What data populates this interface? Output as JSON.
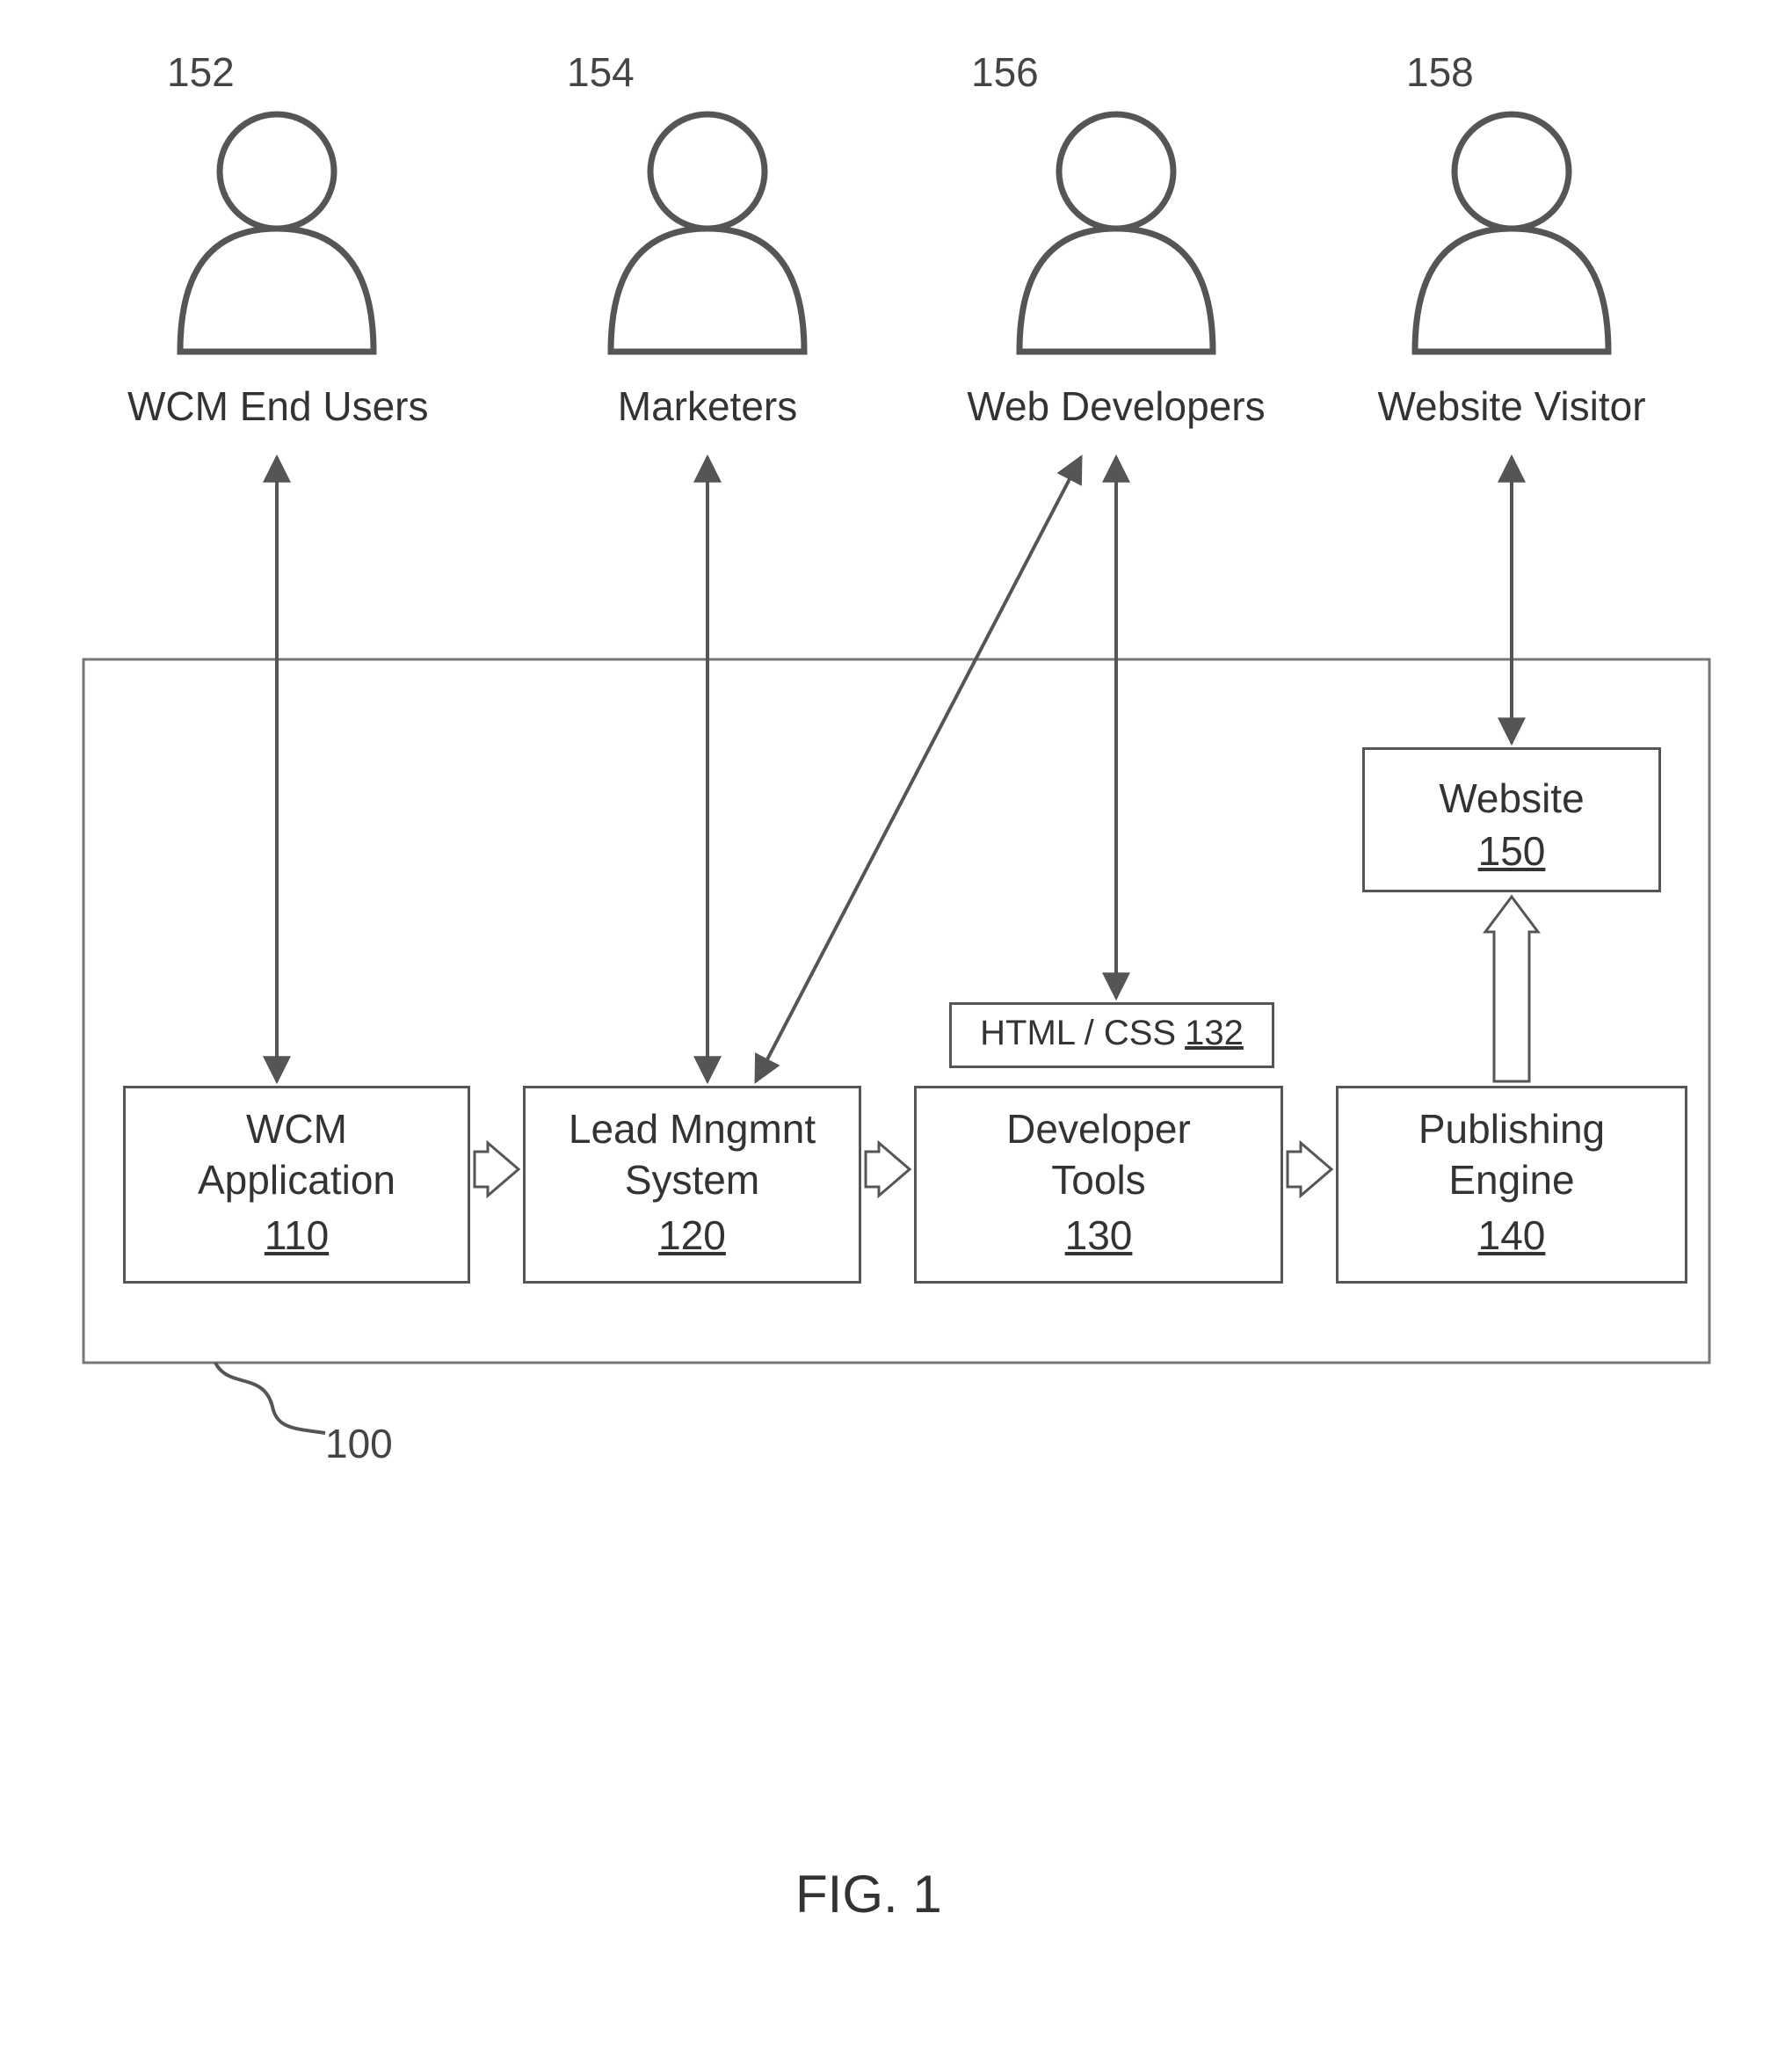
{
  "figure_label": "FIG. 1",
  "system_ref": "100",
  "actors": {
    "a1": {
      "ref": "152",
      "label": "WCM End Users"
    },
    "a2": {
      "ref": "154",
      "label": "Marketers"
    },
    "a3": {
      "ref": "156",
      "label": "Web Developers"
    },
    "a4": {
      "ref": "158",
      "label": "Website Visitor"
    }
  },
  "components": {
    "wcm": {
      "line1": "WCM",
      "line2": "Application",
      "ref": "110"
    },
    "lead": {
      "line1": "Lead Mngmnt",
      "line2": "System",
      "ref": "120"
    },
    "htmlcss": {
      "label": "HTML / CSS",
      "ref": "132"
    },
    "dev": {
      "line1": "Developer",
      "line2": "Tools",
      "ref": "130"
    },
    "pub": {
      "line1": "Publishing",
      "line2": "Engine",
      "ref": "140"
    },
    "website": {
      "label": "Website",
      "ref": "150"
    }
  }
}
